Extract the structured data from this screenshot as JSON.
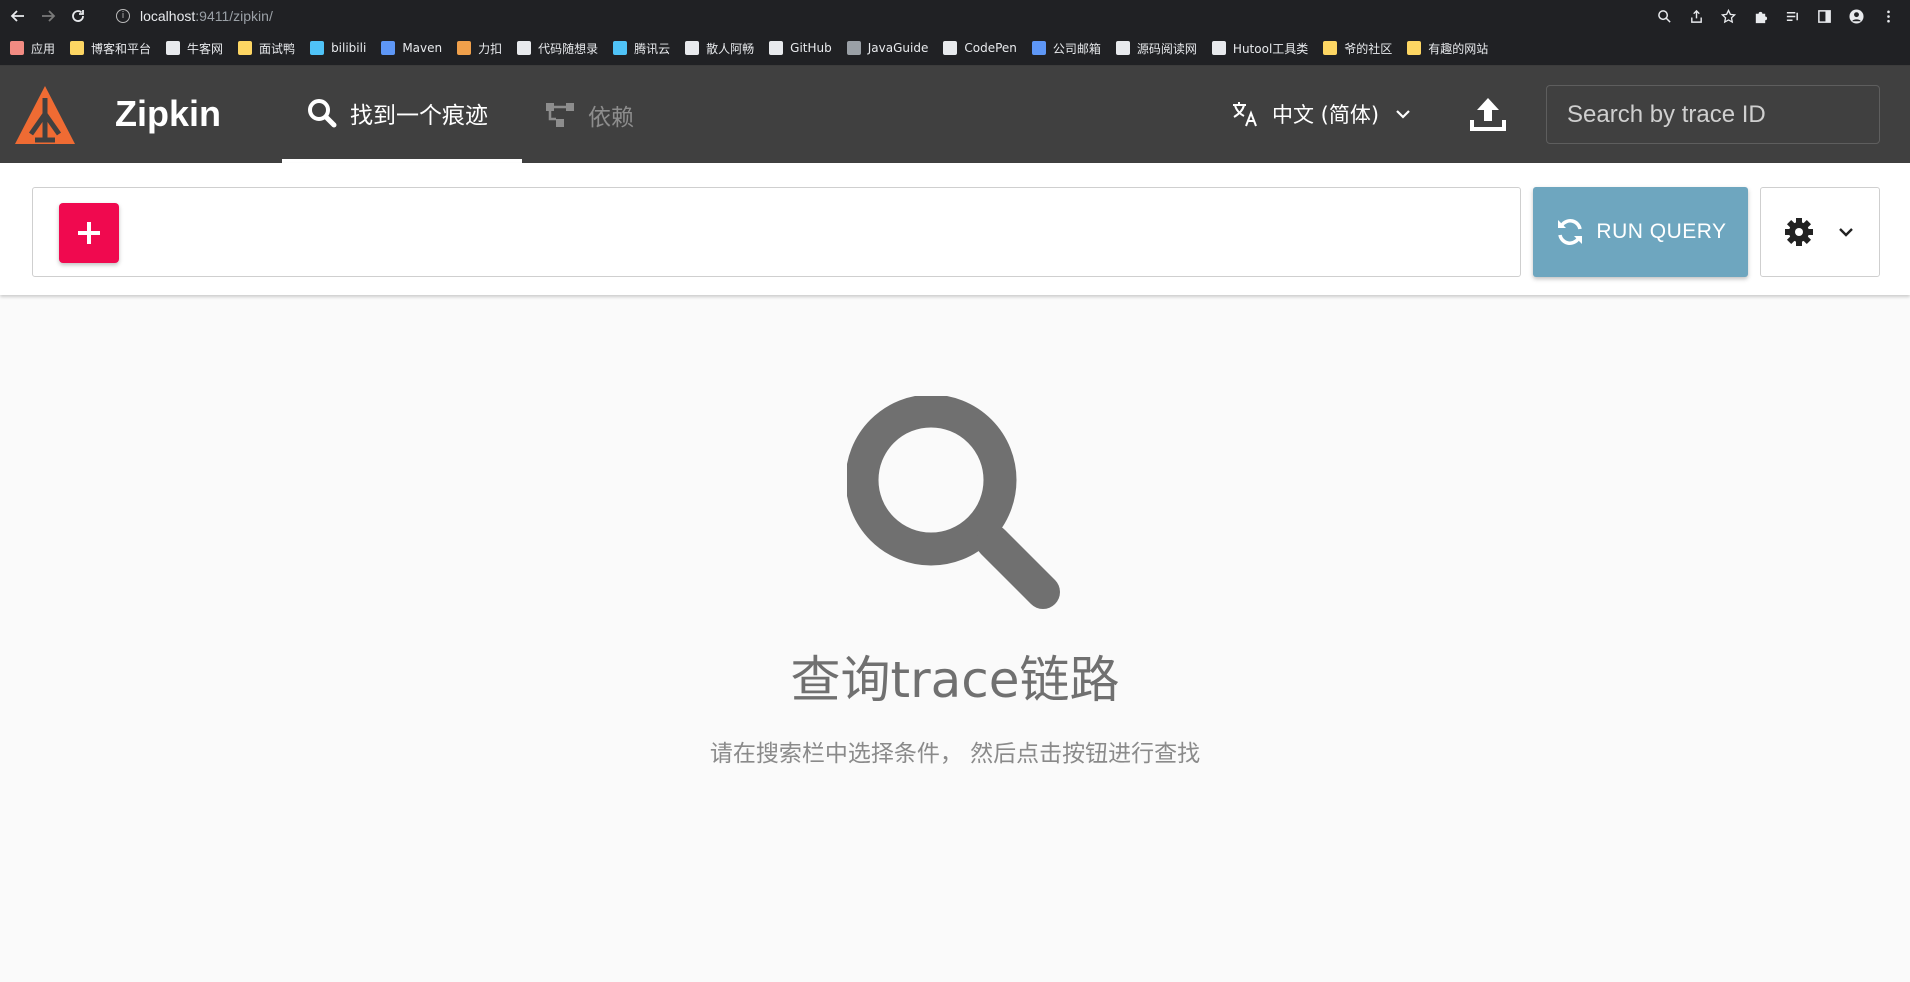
{
  "browser": {
    "url_host": "localhost",
    "url_path": ":9411/zipkin/",
    "bookmarks": [
      {
        "label": "应用",
        "icon": "apps-grid-icon",
        "color": "#f28b82"
      },
      {
        "label": "博客和平台",
        "icon": "folder-icon",
        "color": "#fdd663"
      },
      {
        "label": "牛客网",
        "icon": "nowcoder-icon",
        "color": "#e8eaed"
      },
      {
        "label": "面试鸭",
        "icon": "duck-icon",
        "color": "#fdd663"
      },
      {
        "label": "bilibili",
        "icon": "bilibili-icon",
        "color": "#4fc3f7"
      },
      {
        "label": "Maven",
        "icon": "maven-icon",
        "color": "#5e97f6"
      },
      {
        "label": "力扣",
        "icon": "leetcode-icon",
        "color": "#f0a04b"
      },
      {
        "label": "代码随想录",
        "icon": "p-icon",
        "color": "#e8eaed"
      },
      {
        "label": "腾讯云",
        "icon": "cloud-icon",
        "color": "#4fc3f7"
      },
      {
        "label": "散人阿畅",
        "icon": "chrome-icon",
        "color": "#e8eaed"
      },
      {
        "label": "GitHub",
        "icon": "github-icon",
        "color": "#e8eaed"
      },
      {
        "label": "JavaGuide",
        "icon": "javaguide-icon",
        "color": "#9aa0a6"
      },
      {
        "label": "CodePen",
        "icon": "codepen-icon",
        "color": "#e8eaed"
      },
      {
        "label": "公司邮箱",
        "icon": "mail-icon",
        "color": "#5e97f6"
      },
      {
        "label": "源码阅读网",
        "icon": "source-icon",
        "color": "#e8eaed"
      },
      {
        "label": "Hutool工具类",
        "icon": "hutool-icon",
        "color": "#e8eaed"
      },
      {
        "label": "爷的社区",
        "icon": "folder-icon",
        "color": "#fdd663"
      },
      {
        "label": "有趣的网站",
        "icon": "folder-icon",
        "color": "#fdd663"
      }
    ]
  },
  "header": {
    "brand": "Zipkin",
    "tab_find": "找到一个痕迹",
    "tab_dependencies": "依赖",
    "language": "中文 (简体)",
    "search_placeholder": "Search by trace ID"
  },
  "query": {
    "run_label": "RUN QUERY"
  },
  "empty_state": {
    "title": "查询trace链路",
    "description": "请在搜索栏中选择条件， 然后点击按钮进行查找"
  },
  "colors": {
    "header_bg": "#404040",
    "accent_add": "#f0094f",
    "run_button": "#6ea6bf",
    "logo": "#ef6b33"
  }
}
